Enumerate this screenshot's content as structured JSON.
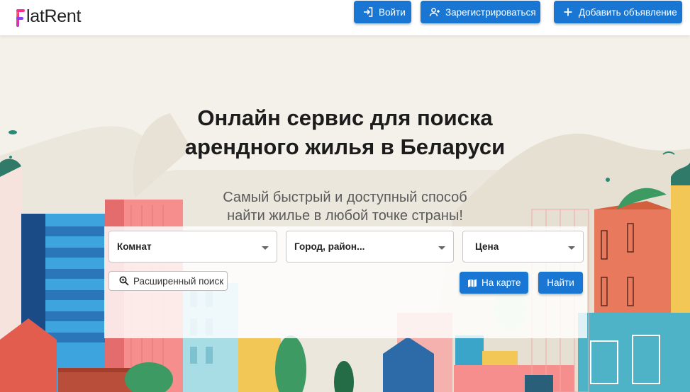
{
  "brand": {
    "name": "latRent",
    "logo_letter": "F",
    "logo_colors": [
      "#ff2d8a",
      "#8b3cf7",
      "#ffb300"
    ]
  },
  "header": {
    "login_label": "Войти",
    "register_label": "Зарегистрироваться",
    "add_listing_label": "Добавить объявление",
    "icons": {
      "login": "login-icon",
      "register": "person-add-icon",
      "add": "plus-icon"
    }
  },
  "hero": {
    "title_line1": "Онлайн сервис для поиска",
    "title_line2": "арендного жилья в Беларуси",
    "subtitle_line1": "Самый быстрый и доступный способ",
    "subtitle_line2": "найти жилье в любой точке страны!"
  },
  "search": {
    "rooms_value": "Комнат",
    "city_value": "Город, район...",
    "price_value": "Цена",
    "advanced_label": "Расширенный поиск",
    "map_label": "На карте",
    "find_label": "Найти",
    "icons": {
      "advanced": "magnifier-icon",
      "map": "map-icon"
    }
  },
  "colors": {
    "accent": "#1976d2",
    "background": "#f4f1ea"
  }
}
